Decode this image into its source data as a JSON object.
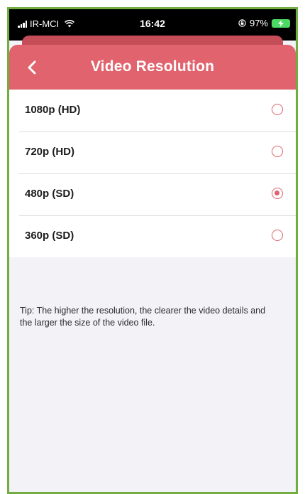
{
  "status_bar": {
    "carrier": "IR-MCI",
    "time": "16:42",
    "battery_percent": "97%",
    "icons": [
      "signal-icon",
      "wifi-icon",
      "orientation-lock-icon",
      "battery-charging-icon"
    ]
  },
  "header": {
    "title": "Video Resolution",
    "back_icon": "chevron-left-icon"
  },
  "options": [
    {
      "label": "1080p (HD)",
      "selected": false
    },
    {
      "label": "720p (HD)",
      "selected": false
    },
    {
      "label": "480p (SD)",
      "selected": true
    },
    {
      "label": "360p (SD)",
      "selected": false
    }
  ],
  "tip": "Tip: The higher the resolution, the clearer the video details and the larger the size of the video file.",
  "colors": {
    "accent": "#e0636d",
    "frame_border": "#72ad42",
    "background": "#f2f2f7",
    "battery": "#4cd964"
  }
}
